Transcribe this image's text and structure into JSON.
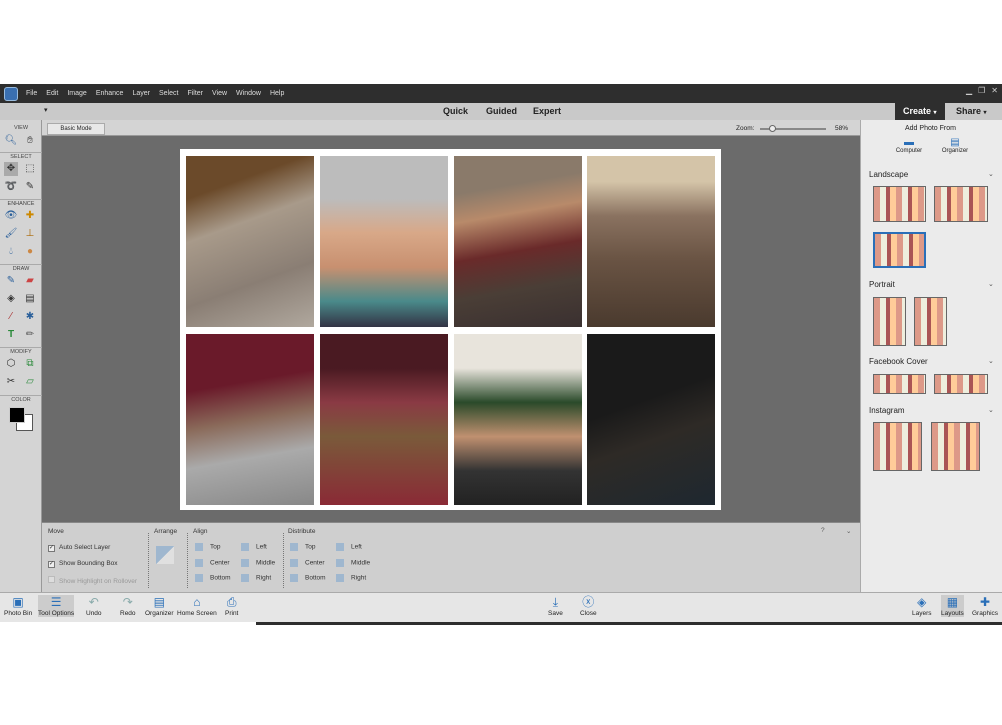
{
  "menu": [
    "File",
    "Edit",
    "Image",
    "Enhance",
    "Layer",
    "Select",
    "Filter",
    "View",
    "Window",
    "Help"
  ],
  "modes": {
    "quick": "Quick",
    "guided": "Guided",
    "expert": "Expert",
    "create": "Create",
    "share": "Share"
  },
  "options": {
    "basic_mode": "Basic Mode",
    "zoom_label": "Zoom:",
    "zoom_value": "58%",
    "zoom_fraction": 0.18
  },
  "toolbox": {
    "sections": [
      "VIEW",
      "SELECT",
      "ENHANCE",
      "DRAW",
      "MODIFY",
      "COLOR"
    ]
  },
  "tool_options": {
    "move": {
      "title": "Move",
      "auto_select": "Auto Select Layer",
      "bounding_box": "Show Bounding Box",
      "highlight": "Show Highlight on Rollover"
    },
    "arrange": {
      "title": "Arrange"
    },
    "align": {
      "title": "Align",
      "items": [
        "Top",
        "Center",
        "Bottom",
        "Left",
        "Middle",
        "Right"
      ]
    },
    "distribute": {
      "title": "Distribute",
      "items": [
        "Top",
        "Center",
        "Bottom",
        "Left",
        "Middle",
        "Right"
      ]
    }
  },
  "right_panel": {
    "add_photo_from": "Add Photo From",
    "computer": "Computer",
    "organizer": "Organizer",
    "categories": [
      "Landscape",
      "Portrait",
      "Facebook Cover",
      "Instagram"
    ]
  },
  "bottom": {
    "photo_bin": "Photo Bin",
    "tool_options": "Tool Options",
    "undo": "Undo",
    "redo": "Redo",
    "organizer": "Organizer",
    "home_screen": "Home Screen",
    "print": "Print",
    "save": "Save",
    "close": "Close",
    "layers": "Layers",
    "layouts": "Layouts",
    "graphics": "Graphics"
  },
  "colors": {
    "accent": "#2a6fb8",
    "dark": "#2e2e2e"
  }
}
